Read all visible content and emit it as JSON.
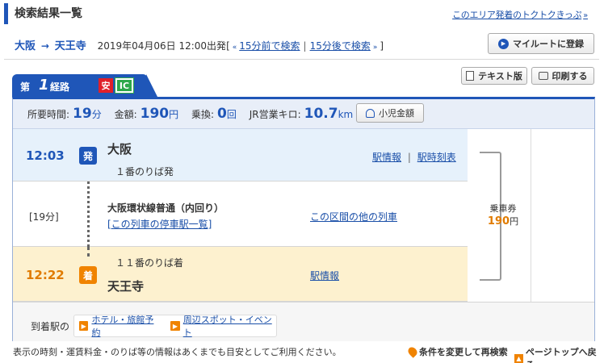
{
  "header": {
    "title": "検索結果一覧",
    "right_link": "このエリア発着のトクトクきっぷ"
  },
  "route": {
    "from": "大阪",
    "arrow": "→",
    "to": "天王寺",
    "datetime": "2019年04月06日 12:00出発",
    "bracket_open": "[",
    "prev_arrow": "«",
    "prev_link": "15分前で検索",
    "sep": "|",
    "next_link": "15分後で検索",
    "next_arrow": "»",
    "bracket_close": "]",
    "my_route_button": "マイルートに登録"
  },
  "tab": {
    "dai": "第",
    "number": "1",
    "keiro": "経路",
    "badge_safe": "安",
    "badge_ic": "IC"
  },
  "toolbar": {
    "text_version": "テキスト版",
    "print": "印刷する"
  },
  "summary": {
    "time_label": "所要時間:",
    "time_value": "19",
    "time_unit": "分",
    "fare_label": "金額:",
    "fare_value": "190",
    "fare_unit": "円",
    "transfer_label": "乗換:",
    "transfer_value": "0",
    "transfer_unit": "回",
    "distance_label": "JR営業キロ:",
    "distance_value": "10.7",
    "distance_unit": "km",
    "child_fare_button": "小児金額"
  },
  "departure": {
    "time": "12:03",
    "mark": "発",
    "station": "大阪",
    "platform": "１番のりば発",
    "link_info": "駅情報",
    "link_sep": "|",
    "link_timetable": "駅時刻表"
  },
  "segment": {
    "duration": "[19分]",
    "train_name": "大阪環状線普通（内回り）",
    "stops_link": "[この列車の停車駅一覧]",
    "other_trains_link": "この区間の他の列車"
  },
  "arrival": {
    "time": "12:22",
    "mark": "着",
    "platform": "１１番のりば着",
    "station": "天王寺",
    "link_info": "駅情報"
  },
  "fare_box": {
    "label": "乗車券",
    "amount": "190",
    "unit": "円"
  },
  "station_links": {
    "label": "到着駅の",
    "hotel": "ホテル・旅館予約",
    "spots": "周辺スポット・イベント"
  },
  "footer": {
    "note": "表示の時刻・運賃料金・のりば等の情報はあくまでも目安としてご利用ください。",
    "research": "条件を変更して再検索",
    "page_top": "ページトップへ戻る"
  },
  "colors": {
    "primary": "#1f56b8",
    "departure_bg": "#e6f1fb",
    "arrival_bg": "#fdf1cf",
    "departure_time": "#1f56b8",
    "arrival_time": "#e07b00",
    "safe_badge": "#e0202a",
    "ic_badge": "#2ea84a"
  }
}
